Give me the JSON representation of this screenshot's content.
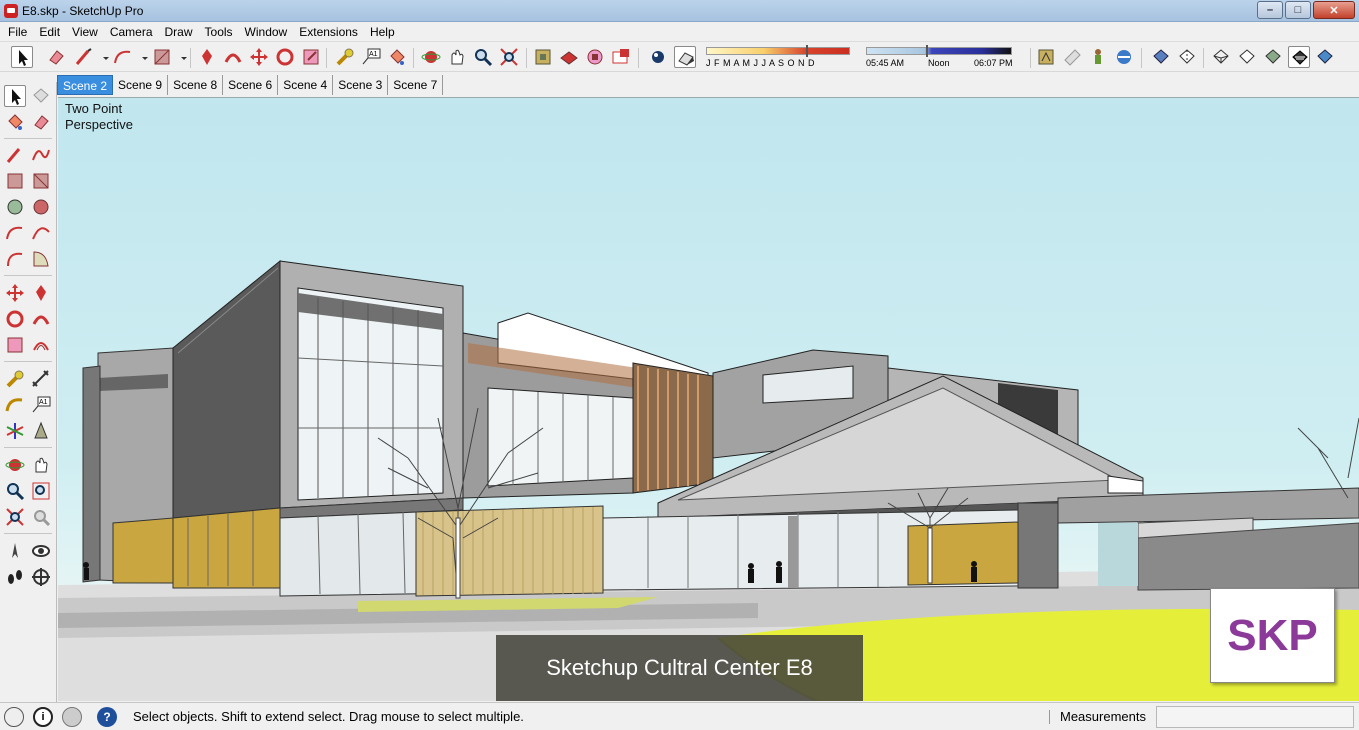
{
  "window": {
    "title": "E8.skp - SketchUp Pro"
  },
  "menu": [
    "File",
    "Edit",
    "View",
    "Camera",
    "Draw",
    "Tools",
    "Window",
    "Extensions",
    "Help"
  ],
  "toolbar": {
    "shadow_months": "J F M A M J J A S O N D",
    "time_start": "05:45 AM",
    "time_noon": "Noon",
    "time_end": "06:07 PM"
  },
  "scenes": [
    "Scene 2",
    "Scene 9",
    "Scene 8",
    "Scene 6",
    "Scene 4",
    "Scene 3",
    "Scene 7"
  ],
  "active_scene": "Scene 2",
  "viewport": {
    "camera_label": "Two Point\nPerspective",
    "caption": "Sketchup Cultral Center E8",
    "badge": "SKP"
  },
  "status": {
    "hint": "Select objects. Shift to extend select. Drag mouse to select multiple.",
    "measurements_label": "Measurements",
    "measurements_value": ""
  },
  "colors": {
    "tab_active": "#3a8ee0",
    "sky": "#c1e6ee",
    "lawn": "#e5ef3a",
    "badge_text": "#8c3a9a"
  }
}
